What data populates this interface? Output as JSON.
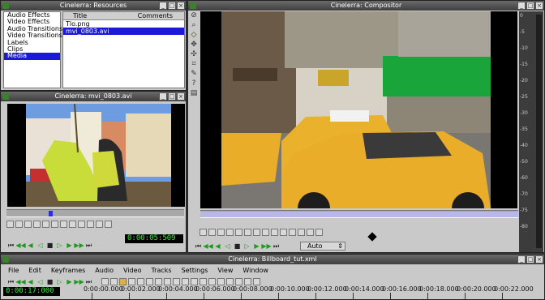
{
  "resources": {
    "title": "Cinelerra: Resources",
    "folders": [
      "Audio Effects",
      "Video Effects",
      "Audio Transitions",
      "Video Transitions",
      "Labels",
      "Clips",
      "Media"
    ],
    "selected_folder": "Media",
    "columns": [
      "Title",
      "Comments"
    ],
    "files": [
      "Tlo.png",
      "mvi_0803.avi"
    ],
    "selected_file": "mvi_0803.avi"
  },
  "viewer": {
    "title": "Cinelerra: mvi_0803.avi",
    "timecode": "0:00:05:509"
  },
  "compositor": {
    "title": "Cinelerra: Compositor",
    "zoom": "Auto",
    "meter_labels": [
      "0",
      "-5",
      "-10",
      "-15",
      "-20",
      "-25",
      "-30",
      "-35",
      "-40",
      "-50",
      "-60",
      "-70",
      "-75",
      "-80"
    ]
  },
  "program": {
    "title": "Cinelerra: Billboard_tut.xml",
    "menu": [
      "File",
      "Edit",
      "Keyframes",
      "Audio",
      "Video",
      "Tracks",
      "Settings",
      "View",
      "Window"
    ],
    "timecode": "0:00:17:000",
    "ruler": [
      "0:00:00.000",
      "0:00:02.000",
      "0:00:04.000",
      "0:00:06.000",
      "0:00:08.000",
      "0:00:10.000",
      "0:00:12.000",
      "0:00:14.000",
      "0:00:16.000",
      "0:00:18.000",
      "0:00:20.000",
      "0:00:22.000"
    ]
  },
  "colors": {
    "selection": "#1a1ad8",
    "lcd_text": "#2ff02f",
    "play_green": "#1b9a1b",
    "taxi_yellow": "#e9ad2a"
  }
}
